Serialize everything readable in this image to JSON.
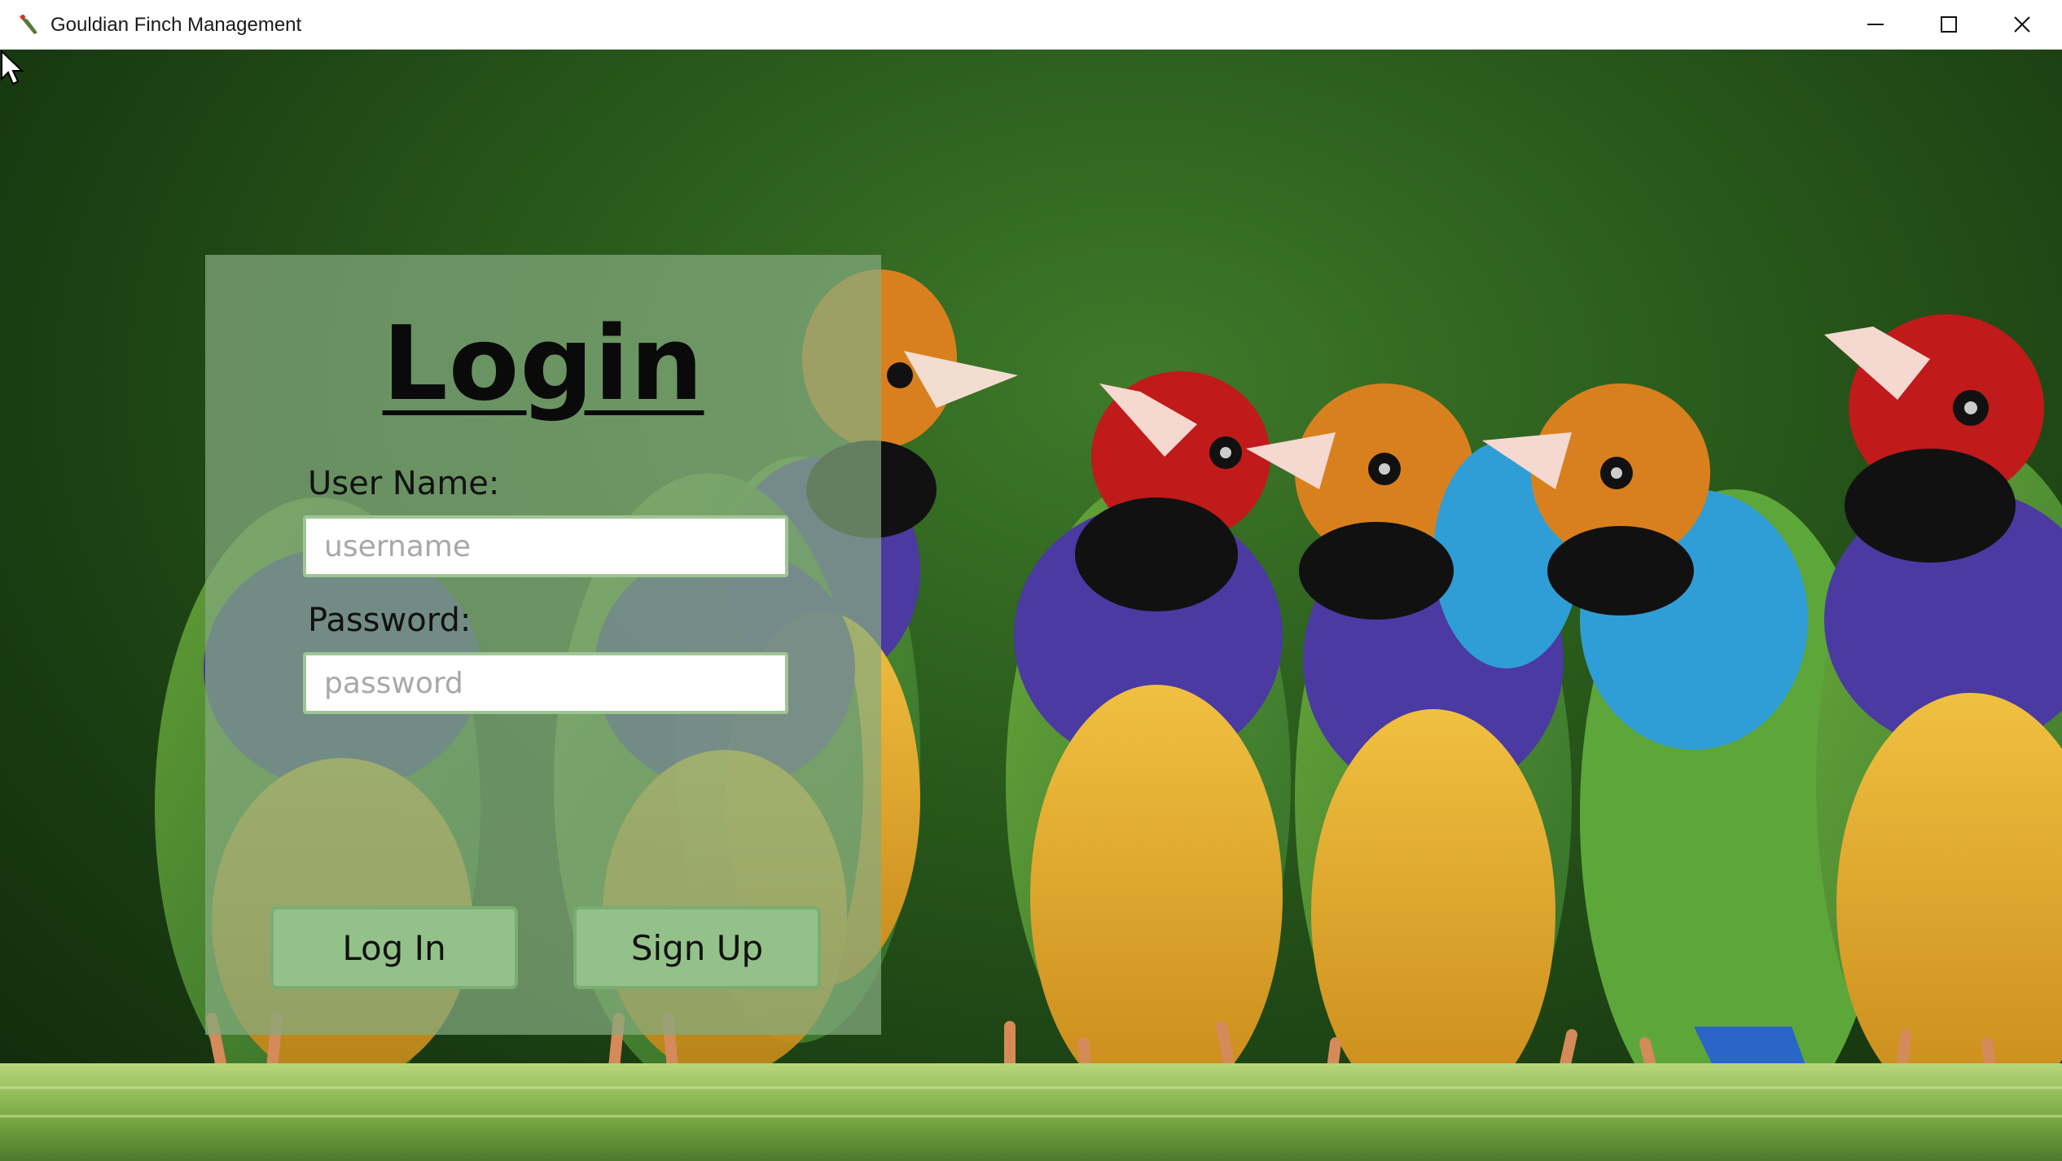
{
  "window": {
    "title": "Gouldian Finch Management",
    "app_icon": "finch-icon",
    "controls": [
      "minimize-icon",
      "maximize-icon",
      "close-icon"
    ]
  },
  "background": {
    "subject": "gouldian-finches-photo",
    "colors": {
      "backdrop": "#2a5c1c",
      "perch": "#7fae4a"
    }
  },
  "login": {
    "title": "Login",
    "username_label": "User Name:",
    "username_value": "",
    "username_placeholder": "username",
    "password_label": "Password:",
    "password_value": "",
    "password_placeholder": "password",
    "login_button": "Log In",
    "signup_button": "Sign Up"
  },
  "colors": {
    "panel": "#85aa80",
    "button": "#94c18a",
    "field_border": "#9fc596"
  }
}
